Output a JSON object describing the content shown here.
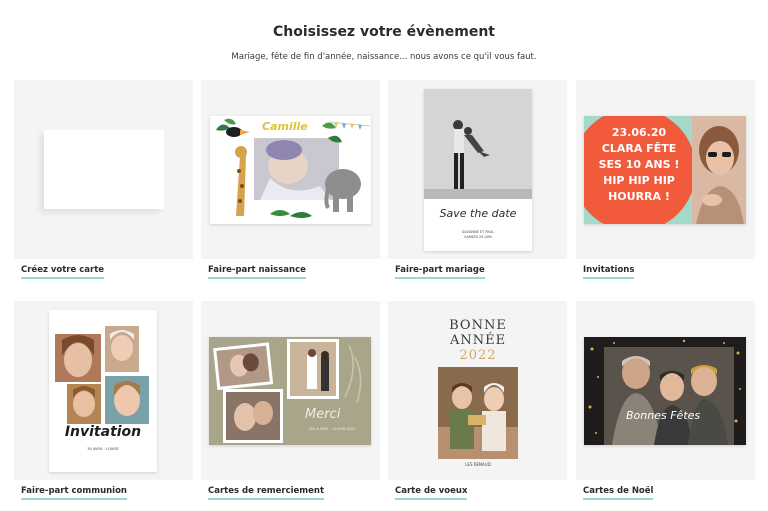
{
  "header": {
    "title": "Choisissez votre évènement",
    "subtitle": "Mariage, fête de fin d'année, naissance... nous avons ce qu'il vous faut."
  },
  "cards": [
    {
      "label": "Créez votre carte"
    },
    {
      "label": "Faire-part naissance",
      "art_text": "Camille"
    },
    {
      "label": "Faire-part mariage",
      "art_text": "Save the date",
      "art_small": "SUZANNE ET PAUL\nSAMEDI 25 JUIN"
    },
    {
      "label": "Invitations",
      "art_lines": [
        "23.06.20",
        "CLARA FÊTE",
        "SES 10 ANS !",
        "HIP HIP HIP",
        "HOURRA !"
      ]
    },
    {
      "label": "Faire-part communion",
      "art_text": "Invitation",
      "art_small": "30 AVRIL · LOUISE"
    },
    {
      "label": "Cartes de remerciement",
      "art_text": "Merci",
      "art_small": "LÉA & PAUL · 30 JUIN 2022"
    },
    {
      "label": "Carte de voeux",
      "art_lines": [
        "BONNE",
        "ANNÉE",
        "2022"
      ],
      "art_small": "LES RENAUD"
    },
    {
      "label": "Cartes de Noël",
      "art_text": "Bonnes Fêtes"
    }
  ],
  "colors": {
    "card_bg": "#f4f4f4",
    "label_underline": "#9bd7d2",
    "invite_orange": "#f25a3c",
    "invite_mint": "#a5d8c8",
    "invite_yellow": "#ffd700",
    "sage": "#a8a58a",
    "christmas_dark": "#1f1d1c"
  }
}
